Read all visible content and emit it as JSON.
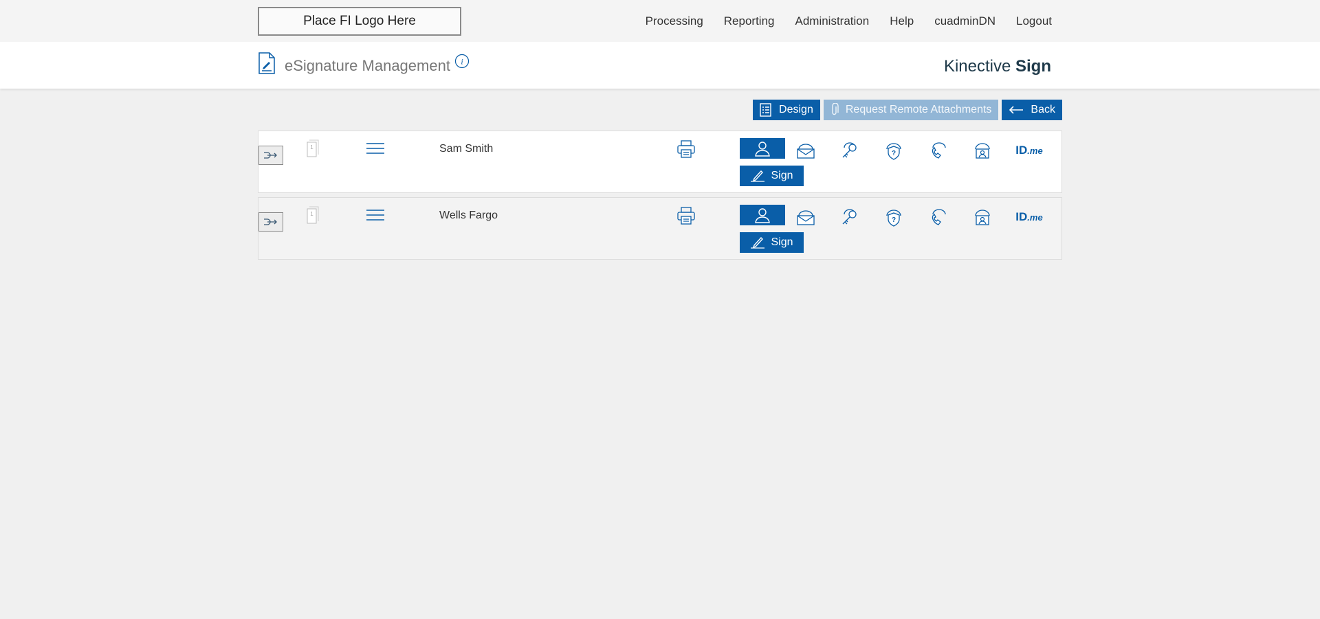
{
  "topbar": {
    "logo_text": "Place FI Logo Here",
    "nav": [
      "Processing",
      "Reporting",
      "Administration",
      "Help",
      "cuadminDN",
      "Logout"
    ]
  },
  "header": {
    "title": "eSignature Management",
    "brand_light": "Kinective ",
    "brand_bold": "Sign"
  },
  "toolbar": {
    "design_label": "Design",
    "request_label": "Request Remote Attachments",
    "back_label": "Back"
  },
  "signers": [
    {
      "name": "Sam Smith",
      "sign_label": "Sign",
      "idme_label": "ID",
      "idme_suffix": ".me"
    },
    {
      "name": "Wells Fargo",
      "sign_label": "Sign",
      "idme_label": "ID",
      "idme_suffix": ".me"
    }
  ],
  "colors": {
    "accent": "#0a5ea8",
    "disabled": "#92b6d6",
    "background": "#f0f0f0"
  }
}
